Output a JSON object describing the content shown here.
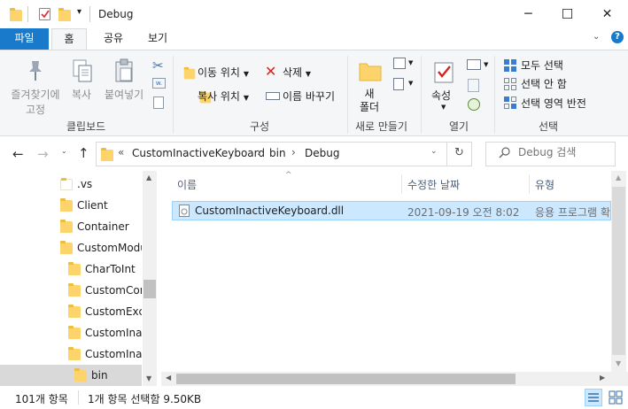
{
  "window": {
    "title": "Debug",
    "minimize": "─",
    "maximize": "☐",
    "close": "✕"
  },
  "tabs": {
    "file": "파일",
    "home": "홈",
    "share": "공유",
    "view": "보기"
  },
  "ribbon": {
    "clipboard": {
      "pin_label": "즐겨찾기에\n고정",
      "pin_line1": "즐겨찾기에",
      "pin_line2": "고정",
      "copy": "복사",
      "paste": "붙여넣기",
      "group": "클립보드"
    },
    "organize": {
      "move_to": "이동 위치",
      "copy_to": "복사 위치",
      "delete": "삭제",
      "rename": "이름 바꾸기",
      "group": "구성"
    },
    "new": {
      "new_folder_line1": "새",
      "new_folder_line2": "폴더",
      "group": "새로 만들기"
    },
    "open": {
      "properties": "속성",
      "group": "열기"
    },
    "select": {
      "select_all": "모두 선택",
      "select_none": "선택 안 함",
      "invert": "선택 영역 반전",
      "group": "선택"
    }
  },
  "address": {
    "overflow": "«",
    "crumbs": [
      "CustomInactiveKeyboard",
      "bin",
      "Debug"
    ],
    "separator": "›",
    "search_placeholder": "Debug 검색"
  },
  "tree": {
    "items": [
      {
        "label": ".vs"
      },
      {
        "label": "Client"
      },
      {
        "label": "Container"
      },
      {
        "label": "CustomModules"
      },
      {
        "label": "CharToInt"
      },
      {
        "label": "CustomControl"
      },
      {
        "label": "CustomException"
      },
      {
        "label": "CustomInactive"
      },
      {
        "label": "CustomInactiveKeyboard"
      },
      {
        "label": "bin"
      }
    ]
  },
  "columns": {
    "name": "이름",
    "modified": "수정한 날짜",
    "type": "유형"
  },
  "files": [
    {
      "name": "CustomInactiveKeyboard.dll",
      "modified": "2021-09-19 오전 8:02",
      "type": "응용 프로그램 확장"
    }
  ],
  "status": {
    "item_count": "101개 항목",
    "selection": "1개 항목 선택함 9.50KB"
  },
  "colors": {
    "accent": "#1979ca",
    "selection": "#cce8ff",
    "selection_border": "#99d1ff",
    "folder": "#fcd46b"
  }
}
